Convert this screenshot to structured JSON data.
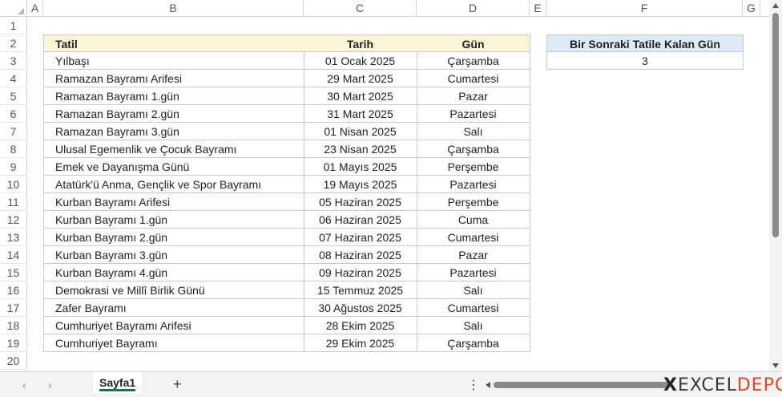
{
  "columns": [
    "A",
    "B",
    "C",
    "D",
    "E",
    "F",
    "G"
  ],
  "rows": [
    "1",
    "2",
    "3",
    "4",
    "5",
    "6",
    "7",
    "8",
    "9",
    "10",
    "11",
    "12",
    "13",
    "14",
    "15",
    "16",
    "17",
    "18",
    "19",
    "20"
  ],
  "table": {
    "headers": {
      "tatil": "Tatil",
      "tarih": "Tarih",
      "gun": "Gün"
    },
    "rows": [
      {
        "tatil": "Yılbaşı",
        "tarih": "01 Ocak 2025",
        "gun": "Çarşamba"
      },
      {
        "tatil": "Ramazan Bayramı Arifesi",
        "tarih": "29 Mart 2025",
        "gun": "Cumartesi"
      },
      {
        "tatil": "Ramazan Bayramı 1.gün",
        "tarih": "30 Mart 2025",
        "gun": "Pazar"
      },
      {
        "tatil": "Ramazan Bayramı 2.gün",
        "tarih": "31 Mart 2025",
        "gun": "Pazartesi"
      },
      {
        "tatil": "Ramazan Bayramı 3.gün",
        "tarih": "01 Nisan 2025",
        "gun": "Salı"
      },
      {
        "tatil": "Ulusal Egemenlik ve Çocuk Bayramı",
        "tarih": "23 Nisan 2025",
        "gun": "Çarşamba"
      },
      {
        "tatil": "Emek ve Dayanışma Günü",
        "tarih": "01 Mayıs 2025",
        "gun": "Perşembe"
      },
      {
        "tatil": "Atatürk'ü Anma, Gençlik ve Spor Bayramı",
        "tarih": "19 Mayıs 2025",
        "gun": "Pazartesi"
      },
      {
        "tatil": "Kurban Bayramı Arifesi",
        "tarih": "05 Haziran 2025",
        "gun": "Perşembe"
      },
      {
        "tatil": "Kurban Bayramı 1.gün",
        "tarih": "06 Haziran 2025",
        "gun": "Cuma"
      },
      {
        "tatil": "Kurban Bayramı 2.gün",
        "tarih": "07 Haziran 2025",
        "gun": "Cumartesi"
      },
      {
        "tatil": "Kurban Bayramı 3.gün",
        "tarih": "08 Haziran 2025",
        "gun": "Pazar"
      },
      {
        "tatil": "Kurban Bayramı 4.gün",
        "tarih": "09 Haziran 2025",
        "gun": "Pazartesi"
      },
      {
        "tatil": "Demokrasi ve Millî Birlik Günü",
        "tarih": "15 Temmuz 2025",
        "gun": "Salı"
      },
      {
        "tatil": "Zafer Bayramı",
        "tarih": "30 Ağustos 2025",
        "gun": "Cumartesi"
      },
      {
        "tatil": "Cumhuriyet Bayramı Arifesi",
        "tarih": "28 Ekim 2025",
        "gun": "Salı"
      },
      {
        "tatil": "Cumhuriyet Bayramı",
        "tarih": "29 Ekim 2025",
        "gun": "Çarşamba"
      }
    ]
  },
  "summary": {
    "header": "Bir Sonraki Tatile Kalan Gün",
    "value": "3"
  },
  "sheet_tab": "Sayfa1",
  "add_sheet": "+",
  "nav_prev": "‹",
  "nav_next": "›",
  "more_options": "⋮",
  "brand": {
    "x": "X",
    "excel": "EXCEL",
    "depo": "DEPO"
  },
  "colors": {
    "table_header": "#fdf3d5",
    "summary_header": "#ddeaf7",
    "tab_accent": "#1e7145",
    "brand_accent": "#e0452e"
  }
}
